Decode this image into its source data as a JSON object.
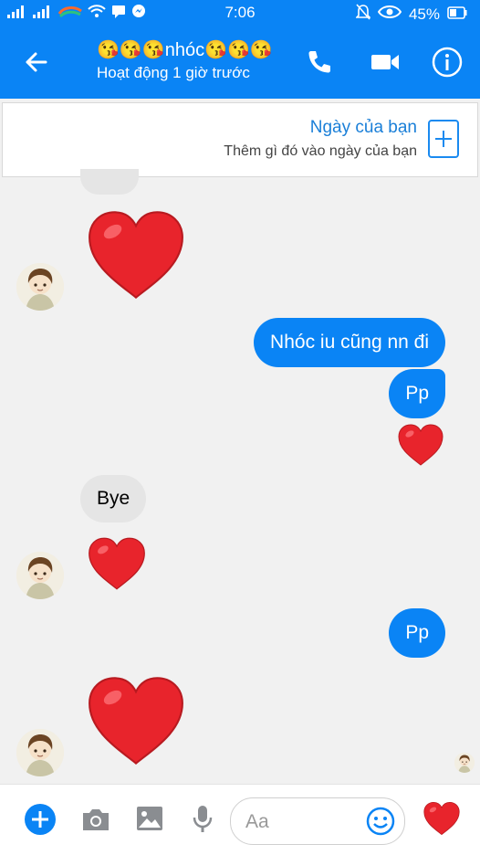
{
  "status_bar": {
    "time": "7:06",
    "battery": "45%"
  },
  "header": {
    "title": "😘😘😘nhóc😘😘😘",
    "subtitle": "Hoạt động 1 giờ trước"
  },
  "banner": {
    "title": "Ngày của bạn",
    "subtitle": "Thêm gì đó vào ngày của bạn"
  },
  "messages": [
    {
      "from": "them",
      "type": "heart"
    },
    {
      "from": "me",
      "type": "text",
      "text": "Nhóc iu cũng nn đi"
    },
    {
      "from": "me",
      "type": "text",
      "text": "Pp"
    },
    {
      "from": "me",
      "type": "heart"
    },
    {
      "from": "them",
      "type": "text",
      "text": "Bye"
    },
    {
      "from": "them",
      "type": "heart"
    },
    {
      "from": "me",
      "type": "text",
      "text": "Pp"
    },
    {
      "from": "them",
      "type": "heart"
    }
  ],
  "composer": {
    "placeholder": "Aa"
  },
  "colors": {
    "brand": "#0a84f5",
    "heart": "#e8242c",
    "incoming_bubble": "#e5e5e5"
  }
}
